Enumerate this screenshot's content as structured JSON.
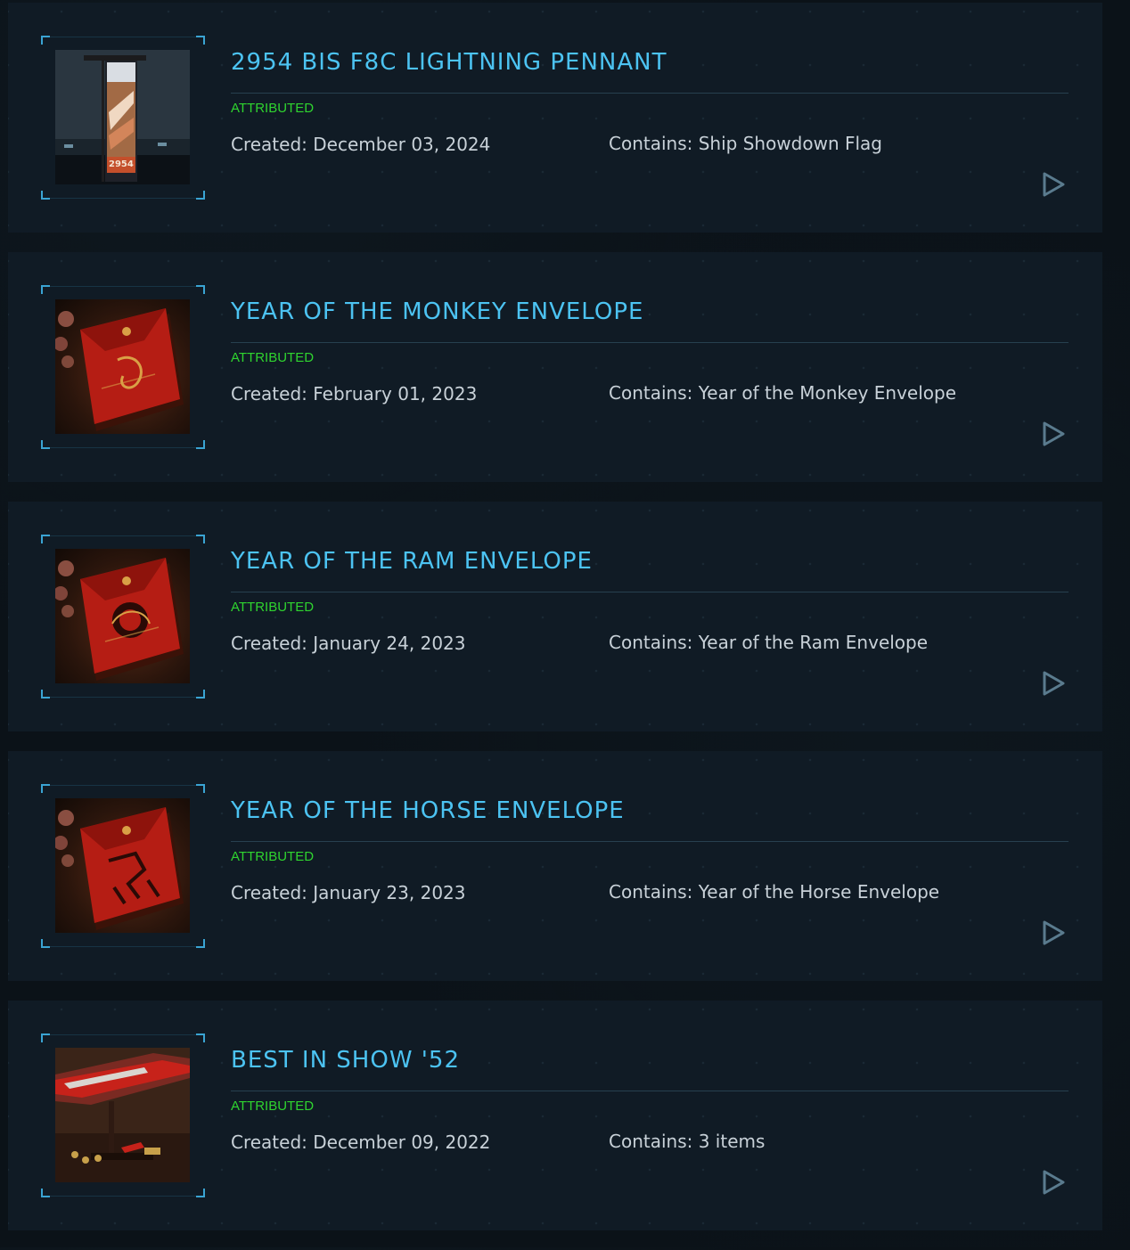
{
  "colors": {
    "title": "#4cc3f2",
    "status": "#2fd42f",
    "text": "#c8d1d8",
    "frame_accent": "#3aa4d3",
    "card_bg": "#101b25",
    "page_bg": "#0b1218"
  },
  "items": [
    {
      "title": "2954 BIS F8C LIGHTNING PENNANT",
      "status": "ATTRIBUTED",
      "created": "Created: December 03, 2024",
      "contains": "Contains: Ship Showdown Flag",
      "image": "pennant-flag-image",
      "image_text": "2954"
    },
    {
      "title": "YEAR OF THE MONKEY ENVELOPE",
      "status": "ATTRIBUTED",
      "created": "Created: February 01, 2023",
      "contains": "Contains: Year of the Monkey Envelope",
      "image": "red-envelope-image"
    },
    {
      "title": "YEAR OF THE RAM ENVELOPE",
      "status": "ATTRIBUTED",
      "created": "Created: January 24, 2023",
      "contains": "Contains: Year of the Ram Envelope",
      "image": "red-envelope-image"
    },
    {
      "title": "YEAR OF THE HORSE ENVELOPE",
      "status": "ATTRIBUTED",
      "created": "Created: January 23, 2023",
      "contains": "Contains: Year of the Horse Envelope",
      "image": "red-envelope-image"
    },
    {
      "title": "BEST IN SHOW '52",
      "status": "ATTRIBUTED",
      "created": "Created: December 09, 2022",
      "contains": "Contains: 3 items",
      "image": "ship-model-image"
    }
  ],
  "icons": {
    "expand": "play-triangle-icon"
  }
}
